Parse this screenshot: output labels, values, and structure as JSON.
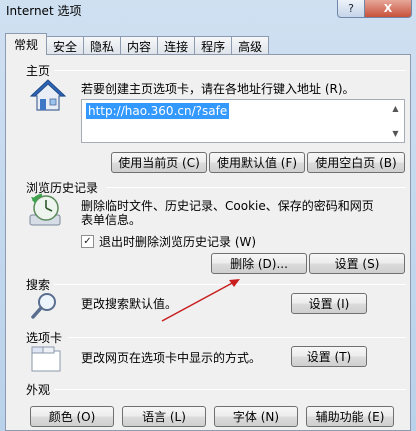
{
  "window": {
    "title": "Internet 选项",
    "help_glyph": "?",
    "close_glyph": "X"
  },
  "tabs": [
    "常规",
    "安全",
    "隐私",
    "内容",
    "连接",
    "程序",
    "高级"
  ],
  "homepage": {
    "title": "主页",
    "description": "若要创建主页选项卡，请在各地址行键入地址 (R)。",
    "url": "http://hao.360.cn/?safe",
    "buttons": [
      "使用当前页 (C)",
      "使用默认值 (F)",
      "使用空白页 (B)"
    ]
  },
  "history": {
    "title": "浏览历史记录",
    "description_line1": "删除临时文件、历史记录、Cookie、保存的密码和网页",
    "description_line2": "表单信息。",
    "checkbox_label": "退出时删除浏览历史记录 (W)",
    "checkbox_checked": true,
    "check_glyph": "✓",
    "delete_button": "删除 (D)...",
    "settings_button": "设置 (S)"
  },
  "search": {
    "title": "搜索",
    "description": "更改搜索默认值。",
    "settings_button": "设置 (I)"
  },
  "tabs_section": {
    "title": "选项卡",
    "description": "更改网页在选项卡中显示的方式。",
    "settings_button": "设置 (T)"
  },
  "appearance": {
    "title": "外观",
    "buttons": [
      "颜色 (O)",
      "语言 (L)",
      "字体 (N)",
      "辅助功能 (E)"
    ]
  },
  "colors": {
    "selection": "#3399ff",
    "annotation_arrow": "#c81e1e"
  }
}
